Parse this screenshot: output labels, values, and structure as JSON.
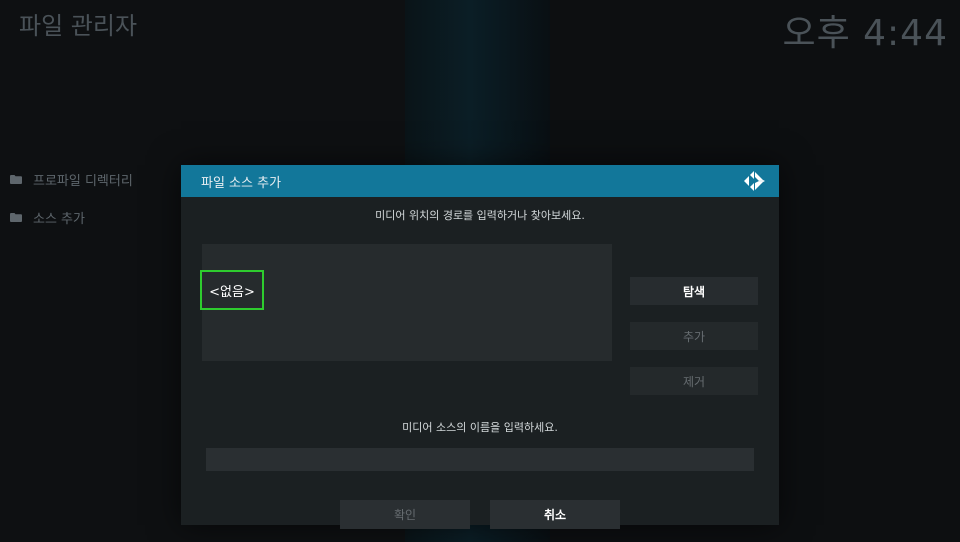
{
  "header": {
    "app_title": "파일 관리자",
    "clock": "오후 4:44"
  },
  "sidebar": {
    "items": [
      {
        "label": "프로파일 디렉터리",
        "icon": "folder-icon"
      },
      {
        "label": "소스 추가",
        "icon": "folder-icon"
      }
    ]
  },
  "dialog": {
    "title": "파일 소스 추가",
    "path_hint": "미디어 위치의 경로를 입력하거나 찾아보세요.",
    "paths": [
      "<없음>"
    ],
    "buttons": {
      "browse": "탐색",
      "add": "추가",
      "remove": "제거"
    },
    "name_hint": "미디어 소스의 이름을 입력하세요.",
    "name_value": "",
    "ok": "확인",
    "cancel": "취소"
  },
  "colors": {
    "header_accent": "#12779a",
    "focus_border": "#2ecc2e",
    "dialog_bg": "#1b2022"
  }
}
